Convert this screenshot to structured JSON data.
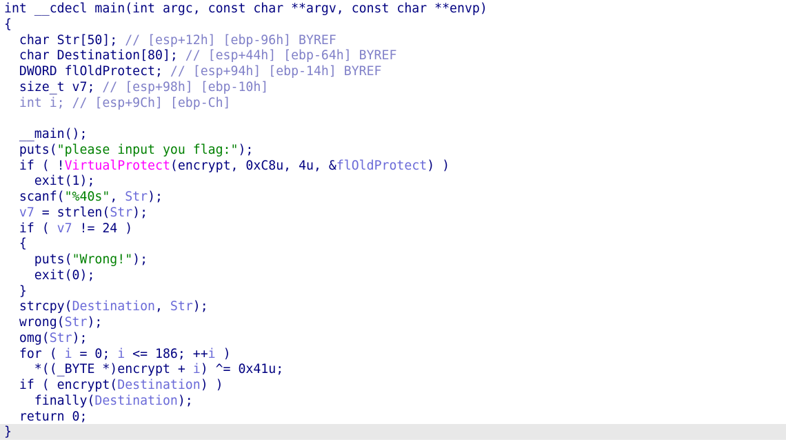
{
  "window": {
    "current_line": 27
  },
  "colors": {
    "background": "#ffffff",
    "current_line_background": "#e8e8e8",
    "plain": "#000080",
    "variable": "#6a6ad8",
    "string": "#008000",
    "import": "#ff00ff",
    "comment": "#8080c8"
  },
  "lines": [
    [
      [
        "plain",
        "int __cdecl main(int argc, const char **argv, const char **envp)"
      ]
    ],
    [
      [
        "plain",
        "{"
      ]
    ],
    [
      [
        "plain",
        "  char Str[50]; "
      ],
      [
        "comment",
        "// [esp+12h] [ebp-96h] BYREF"
      ]
    ],
    [
      [
        "plain",
        "  char Destination[80]; "
      ],
      [
        "comment",
        "// [esp+44h] [ebp-64h] BYREF"
      ]
    ],
    [
      [
        "plain",
        "  DWORD flOldProtect; "
      ],
      [
        "comment",
        "// [esp+94h] [ebp-14h] BYREF"
      ]
    ],
    [
      [
        "plain",
        "  size_t v7; "
      ],
      [
        "comment",
        "// [esp+98h] [ebp-10h]"
      ]
    ],
    [
      [
        "comment",
        "  int i; "
      ],
      [
        "comment",
        "// [esp+9Ch] [ebp-Ch]"
      ]
    ],
    [
      [
        "plain",
        ""
      ]
    ],
    [
      [
        "plain",
        "  __main();"
      ]
    ],
    [
      [
        "plain",
        "  puts("
      ],
      [
        "str",
        "\"please input you flag:\""
      ],
      [
        "plain",
        ");"
      ]
    ],
    [
      [
        "plain",
        "  if ( !"
      ],
      [
        "import",
        "VirtualProtect"
      ],
      [
        "plain",
        "(encrypt, 0xC8u, 4u, &"
      ],
      [
        "var",
        "flOldProtect"
      ],
      [
        "plain",
        ") )"
      ]
    ],
    [
      [
        "plain",
        "    exit(1);"
      ]
    ],
    [
      [
        "plain",
        "  scanf("
      ],
      [
        "str",
        "\"%40s\""
      ],
      [
        "plain",
        ", "
      ],
      [
        "var",
        "Str"
      ],
      [
        "plain",
        ");"
      ]
    ],
    [
      [
        "plain",
        "  "
      ],
      [
        "var",
        "v7"
      ],
      [
        "plain",
        " = strlen("
      ],
      [
        "var",
        "Str"
      ],
      [
        "plain",
        ");"
      ]
    ],
    [
      [
        "plain",
        "  if ( "
      ],
      [
        "var",
        "v7"
      ],
      [
        "plain",
        " != 24 )"
      ]
    ],
    [
      [
        "plain",
        "  {"
      ]
    ],
    [
      [
        "plain",
        "    puts("
      ],
      [
        "str",
        "\"Wrong!\""
      ],
      [
        "plain",
        ");"
      ]
    ],
    [
      [
        "plain",
        "    exit(0);"
      ]
    ],
    [
      [
        "plain",
        "  }"
      ]
    ],
    [
      [
        "plain",
        "  strcpy("
      ],
      [
        "var",
        "Destination"
      ],
      [
        "plain",
        ", "
      ],
      [
        "var",
        "Str"
      ],
      [
        "plain",
        ");"
      ]
    ],
    [
      [
        "plain",
        "  wrong("
      ],
      [
        "var",
        "Str"
      ],
      [
        "plain",
        ");"
      ]
    ],
    [
      [
        "plain",
        "  omg("
      ],
      [
        "var",
        "Str"
      ],
      [
        "plain",
        ");"
      ]
    ],
    [
      [
        "plain",
        "  for ( "
      ],
      [
        "var",
        "i"
      ],
      [
        "plain",
        " = 0; "
      ],
      [
        "var",
        "i"
      ],
      [
        "plain",
        " <= 186; ++"
      ],
      [
        "var",
        "i"
      ],
      [
        "plain",
        " )"
      ]
    ],
    [
      [
        "plain",
        "    *((_BYTE *)encrypt + "
      ],
      [
        "var",
        "i"
      ],
      [
        "plain",
        ") ^= 0x41u;"
      ]
    ],
    [
      [
        "plain",
        "  if ( encrypt("
      ],
      [
        "var",
        "Destination"
      ],
      [
        "plain",
        ") )"
      ]
    ],
    [
      [
        "plain",
        "    finally("
      ],
      [
        "var",
        "Destination"
      ],
      [
        "plain",
        ");"
      ]
    ],
    [
      [
        "plain",
        "  return 0;"
      ]
    ],
    [
      [
        "plain",
        "}"
      ]
    ]
  ]
}
